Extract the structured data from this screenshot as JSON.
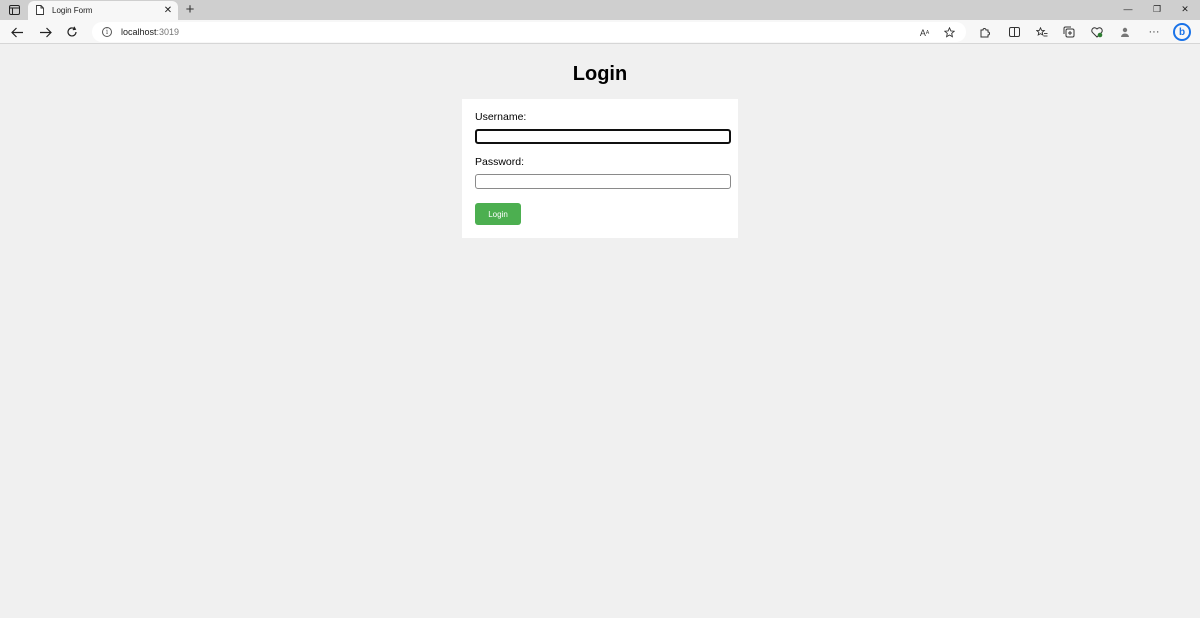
{
  "browser": {
    "tab": {
      "title": "Login Form",
      "close_glyph": "✕"
    },
    "new_tab_glyph": "+",
    "window_controls": {
      "minimize": "—",
      "restore": "❐",
      "close": "✕"
    },
    "address": {
      "host": "localhost",
      "port": ":3019"
    },
    "read_aloud_label": "A",
    "icons": [
      "tab-actions-icon",
      "page-icon",
      "back-arrow-icon",
      "forward-arrow-icon",
      "reload-icon",
      "site-info-icon",
      "read-aloud-icon",
      "add-favorite-icon",
      "extensions-icon",
      "split-screen-icon",
      "favorites-icon",
      "collections-icon",
      "browser-essentials-icon",
      "profile-icon",
      "more-menu-icon",
      "bing-copilot-icon"
    ]
  },
  "page": {
    "title": "Login",
    "form": {
      "username_label": "Username:",
      "username_value": "",
      "password_label": "Password:",
      "password_value": "",
      "submit_label": "Login"
    }
  },
  "colors": {
    "page_background": "#f0f0f0",
    "button_green": "#4caf50",
    "bing_blue": "#1a73e8"
  }
}
